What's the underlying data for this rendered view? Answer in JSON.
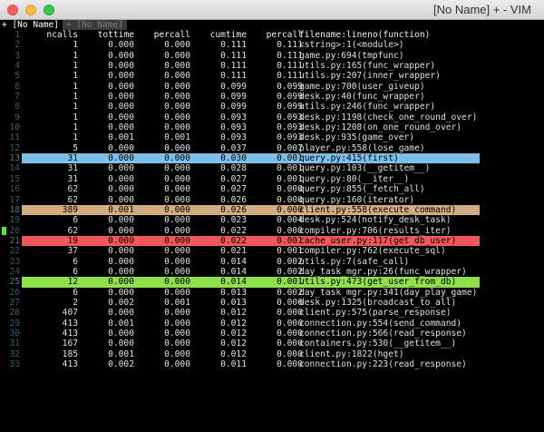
{
  "window": {
    "title": "[No Name] + - VIM",
    "colors": {
      "blue": "#7ec0e8",
      "tan": "#d3ad80",
      "red": "#f0585a",
      "green": "#8ee04c"
    }
  },
  "tabs": [
    {
      "label": "+ [No Name]",
      "active": true
    },
    {
      "label": "+ [No Name]",
      "active": false
    }
  ],
  "header": {
    "lnr": "1",
    "ncalls": "ncalls",
    "tottime": "tottime",
    "percall1": "percall",
    "cumtime": "cumtime",
    "percall2": "percall",
    "func": "filename:lineno(function)"
  },
  "rows": [
    {
      "lnr": "2",
      "ncalls": "1",
      "tottime": "0.000",
      "percall1": "0.000",
      "cumtime": "0.111",
      "percall2": "0.111",
      "func": "<string>:1(<module>)",
      "hl": "",
      "sign": false
    },
    {
      "lnr": "3",
      "ncalls": "1",
      "tottime": "0.000",
      "percall1": "0.000",
      "cumtime": "0.111",
      "percall2": "0.111",
      "func": "game.py:694(tmpfunc)",
      "hl": "",
      "sign": false
    },
    {
      "lnr": "4",
      "ncalls": "1",
      "tottime": "0.000",
      "percall1": "0.000",
      "cumtime": "0.111",
      "percall2": "0.111",
      "func": "utils.py:165(func_wrapper)",
      "hl": "",
      "sign": false
    },
    {
      "lnr": "5",
      "ncalls": "1",
      "tottime": "0.000",
      "percall1": "0.000",
      "cumtime": "0.111",
      "percall2": "0.111",
      "func": "utils.py:207(inner_wrapper)",
      "hl": "",
      "sign": false
    },
    {
      "lnr": "6",
      "ncalls": "1",
      "tottime": "0.000",
      "percall1": "0.000",
      "cumtime": "0.099",
      "percall2": "0.099",
      "func": "game.py:700(user_giveup)",
      "hl": "",
      "sign": false
    },
    {
      "lnr": "7",
      "ncalls": "1",
      "tottime": "0.000",
      "percall1": "0.000",
      "cumtime": "0.099",
      "percall2": "0.099",
      "func": "desk.py:40(func_wrapper)",
      "hl": "",
      "sign": false
    },
    {
      "lnr": "8",
      "ncalls": "1",
      "tottime": "0.000",
      "percall1": "0.000",
      "cumtime": "0.099",
      "percall2": "0.099",
      "func": "utils.py:246(func_wrapper)",
      "hl": "",
      "sign": false
    },
    {
      "lnr": "9",
      "ncalls": "1",
      "tottime": "0.000",
      "percall1": "0.000",
      "cumtime": "0.093",
      "percall2": "0.093",
      "func": "desk.py:1198(check_one_round_over)",
      "hl": "",
      "sign": false
    },
    {
      "lnr": "10",
      "ncalls": "1",
      "tottime": "0.000",
      "percall1": "0.000",
      "cumtime": "0.093",
      "percall2": "0.093",
      "func": "desk.py:1208(on_one_round_over)",
      "hl": "",
      "sign": false
    },
    {
      "lnr": "11",
      "ncalls": "1",
      "tottime": "0.001",
      "percall1": "0.001",
      "cumtime": "0.093",
      "percall2": "0.093",
      "func": "desk.py:935(game_over)",
      "hl": "",
      "sign": false
    },
    {
      "lnr": "12",
      "ncalls": "5",
      "tottime": "0.000",
      "percall1": "0.000",
      "cumtime": "0.037",
      "percall2": "0.007",
      "func": "player.py:558(lose_game)",
      "hl": "",
      "sign": false
    },
    {
      "lnr": "13",
      "ncalls": "31",
      "tottime": "0.000",
      "percall1": "0.000",
      "cumtime": "0.030",
      "percall2": "0.001",
      "func": "query.py:415(first)",
      "hl": "blue",
      "sign": false
    },
    {
      "lnr": "14",
      "ncalls": "31",
      "tottime": "0.000",
      "percall1": "0.000",
      "cumtime": "0.028",
      "percall2": "0.001",
      "func": "query.py:103(__getitem__)",
      "hl": "",
      "sign": false
    },
    {
      "lnr": "15",
      "ncalls": "31",
      "tottime": "0.000",
      "percall1": "0.000",
      "cumtime": "0.027",
      "percall2": "0.001",
      "func": "query.py:80(__iter__)",
      "hl": "",
      "sign": false
    },
    {
      "lnr": "16",
      "ncalls": "62",
      "tottime": "0.000",
      "percall1": "0.000",
      "cumtime": "0.027",
      "percall2": "0.000",
      "func": "query.py:855(_fetch_all)",
      "hl": "",
      "sign": false
    },
    {
      "lnr": "17",
      "ncalls": "62",
      "tottime": "0.000",
      "percall1": "0.000",
      "cumtime": "0.026",
      "percall2": "0.000",
      "func": "query.py:160(iterator)",
      "hl": "",
      "sign": false
    },
    {
      "lnr": "18",
      "ncalls": "389",
      "tottime": "0.001",
      "percall1": "0.000",
      "cumtime": "0.026",
      "percall2": "0.000",
      "func": "client.py:558(execute_command)",
      "hl": "tan",
      "sign": false
    },
    {
      "lnr": "19",
      "ncalls": "6",
      "tottime": "0.000",
      "percall1": "0.000",
      "cumtime": "0.023",
      "percall2": "0.004",
      "func": "desk.py:524(notify_desk_task)",
      "hl": "",
      "sign": false
    },
    {
      "lnr": "20",
      "ncalls": "62",
      "tottime": "0.000",
      "percall1": "0.000",
      "cumtime": "0.022",
      "percall2": "0.000",
      "func": "compiler.py:706(results_iter)",
      "hl": "",
      "sign": true
    },
    {
      "lnr": "21",
      "ncalls": "19",
      "tottime": "0.000",
      "percall1": "0.000",
      "cumtime": "0.022",
      "percall2": "0.001",
      "func": "cache_user.py:117(get_db_user)",
      "hl": "red",
      "sign": false
    },
    {
      "lnr": "22",
      "ncalls": "37",
      "tottime": "0.000",
      "percall1": "0.000",
      "cumtime": "0.021",
      "percall2": "0.001",
      "func": "compiler.py:762(execute_sql)",
      "hl": "",
      "sign": false
    },
    {
      "lnr": "23",
      "ncalls": "6",
      "tottime": "0.000",
      "percall1": "0.000",
      "cumtime": "0.014",
      "percall2": "0.002",
      "func": "utils.py:7(safe_call)",
      "hl": "",
      "sign": false
    },
    {
      "lnr": "24",
      "ncalls": "6",
      "tottime": "0.000",
      "percall1": "0.000",
      "cumtime": "0.014",
      "percall2": "0.002",
      "func": "day_task_mgr.py:26(func_wrapper)",
      "hl": "",
      "sign": false
    },
    {
      "lnr": "25",
      "ncalls": "12",
      "tottime": "0.000",
      "percall1": "0.000",
      "cumtime": "0.014",
      "percall2": "0.001",
      "func": "utils.py:473(get_user_from_db)",
      "hl": "green",
      "sign": false
    },
    {
      "lnr": "26",
      "ncalls": "6",
      "tottime": "0.000",
      "percall1": "0.000",
      "cumtime": "0.013",
      "percall2": "0.002",
      "func": "day_task_mgr.py:341(day_play_game)",
      "hl": "",
      "sign": false
    },
    {
      "lnr": "27",
      "ncalls": "2",
      "tottime": "0.002",
      "percall1": "0.001",
      "cumtime": "0.013",
      "percall2": "0.006",
      "func": "desk.py:1325(broadcast_to_all)",
      "hl": "",
      "sign": false
    },
    {
      "lnr": "28",
      "ncalls": "407",
      "tottime": "0.000",
      "percall1": "0.000",
      "cumtime": "0.012",
      "percall2": "0.000",
      "func": "client.py:575(parse_response)",
      "hl": "",
      "sign": false
    },
    {
      "lnr": "29",
      "ncalls": "413",
      "tottime": "0.001",
      "percall1": "0.000",
      "cumtime": "0.012",
      "percall2": "0.000",
      "func": "connection.py:554(send_command)",
      "hl": "",
      "sign": false
    },
    {
      "lnr": "30",
      "ncalls": "413",
      "tottime": "0.000",
      "percall1": "0.000",
      "cumtime": "0.012",
      "percall2": "0.000",
      "func": "connection.py:566(read_response)",
      "hl": "",
      "sign": false
    },
    {
      "lnr": "31",
      "ncalls": "167",
      "tottime": "0.000",
      "percall1": "0.000",
      "cumtime": "0.012",
      "percall2": "0.000",
      "func": "containers.py:530(__getitem__)",
      "hl": "",
      "sign": false
    },
    {
      "lnr": "32",
      "ncalls": "185",
      "tottime": "0.001",
      "percall1": "0.000",
      "cumtime": "0.012",
      "percall2": "0.000",
      "func": "client.py:1822(hget)",
      "hl": "",
      "sign": false
    },
    {
      "lnr": "33",
      "ncalls": "413",
      "tottime": "0.002",
      "percall1": "0.000",
      "cumtime": "0.011",
      "percall2": "0.000",
      "func": "connection.py:223(read_response)",
      "hl": "",
      "sign": false
    }
  ]
}
